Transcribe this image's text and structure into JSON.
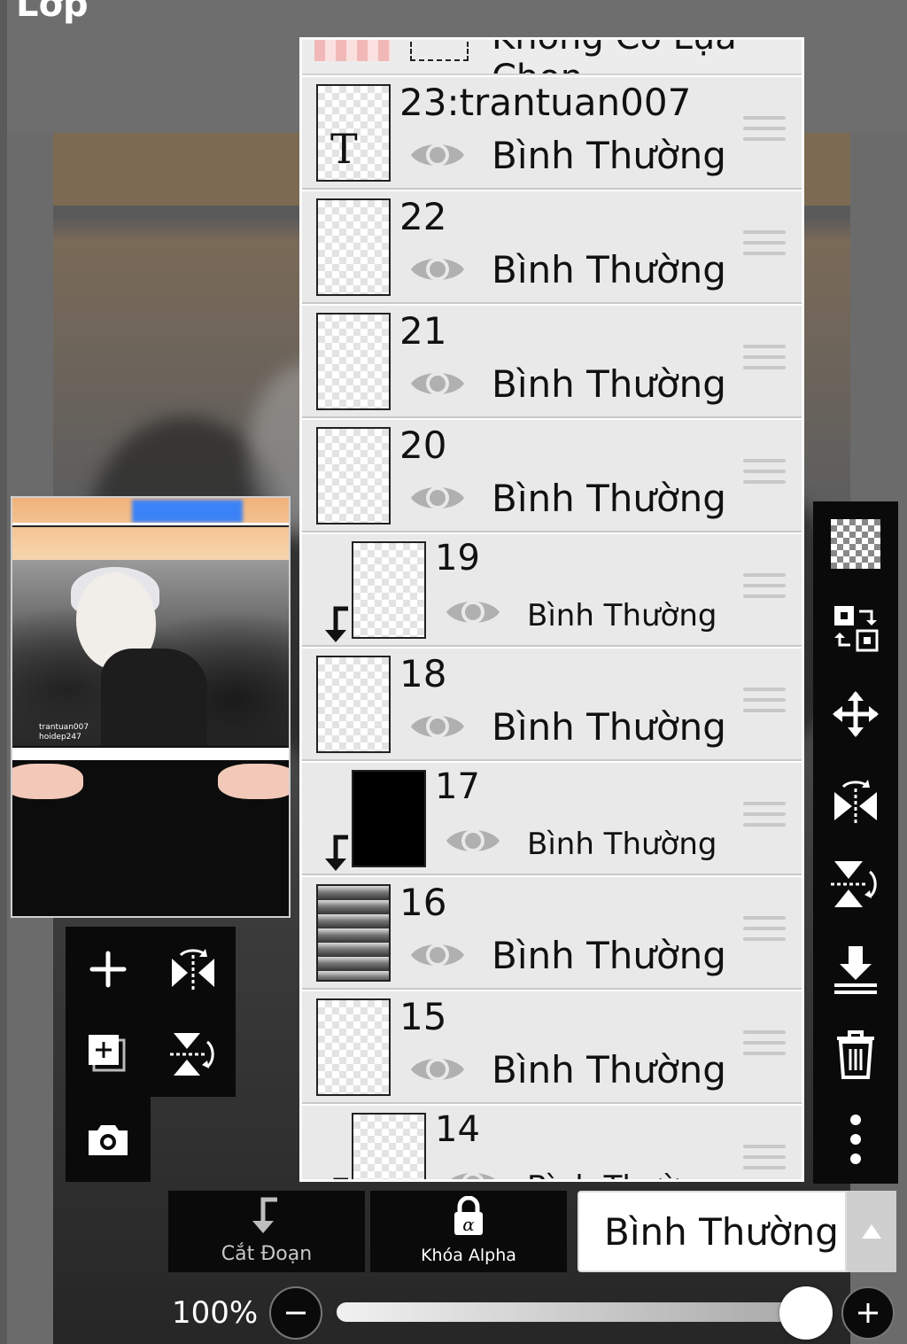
{
  "app": {
    "title": "Lớp"
  },
  "preview": {
    "signature_line1": "trantuan007",
    "signature_line2": "hoidep247"
  },
  "layers": {
    "none_selection_label": "Không Có Lựa Chọn",
    "items": [
      {
        "name": "23:trantuan007",
        "mode": "Bình Thường",
        "visible": true,
        "clipped": false,
        "text_layer": true
      },
      {
        "name": "22",
        "mode": "Bình Thường",
        "visible": true,
        "clipped": false
      },
      {
        "name": "21",
        "mode": "Bình Thường",
        "visible": true,
        "clipped": false
      },
      {
        "name": "20",
        "mode": "Bình Thường",
        "visible": true,
        "clipped": false
      },
      {
        "name": "19",
        "mode": "Bình Thường",
        "visible": true,
        "clipped": true
      },
      {
        "name": "18",
        "mode": "Bình Thường",
        "visible": true,
        "clipped": false
      },
      {
        "name": "17",
        "mode": "Bình Thường",
        "visible": true,
        "clipped": true
      },
      {
        "name": "16",
        "mode": "Bình Thường",
        "visible": true,
        "clipped": false
      },
      {
        "name": "15",
        "mode": "Bình Thường",
        "visible": true,
        "clipped": false
      },
      {
        "name": "14",
        "mode": "Bình Thường",
        "visible": true,
        "clipped": true
      }
    ]
  },
  "left_tools": [
    "add-layer-icon",
    "flip-horizontal-icon",
    "add-copy-layer-icon",
    "flip-vertical-icon",
    "camera-icon"
  ],
  "right_tools": [
    "transparent-checker-icon",
    "swap-layers-icon",
    "move-icon",
    "flip-horizontal-icon",
    "flip-vertical-icon",
    "merge-down-icon",
    "trash-icon",
    "more-icon"
  ],
  "bottom": {
    "clip_label": "Cắt Đoạn",
    "alpha_lock_label": "Khóa Alpha",
    "blend_mode": "Bình Thường"
  },
  "opacity": {
    "label": "100%",
    "value": 1.0
  },
  "colors": {
    "panel_bg": "#e9e9e9",
    "toolbar_bg": "#0a0a0a",
    "icon": "#ffffff"
  }
}
